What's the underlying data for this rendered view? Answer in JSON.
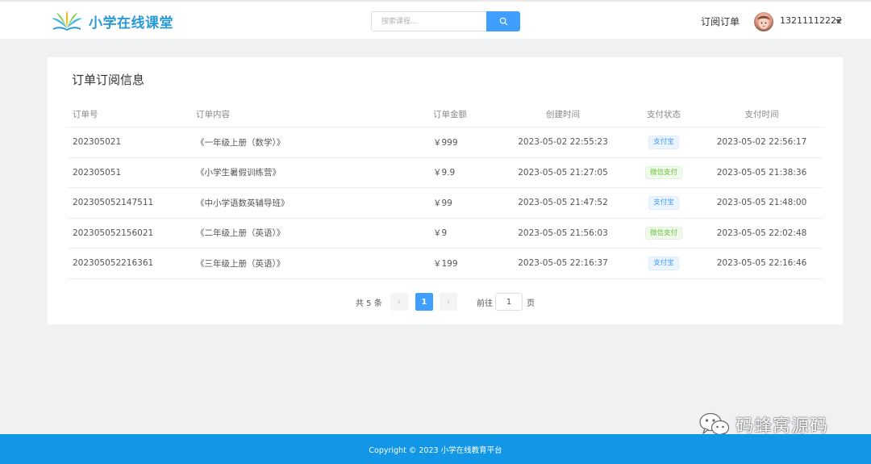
{
  "header": {
    "logo_text": "小学在线课堂",
    "search_placeholder": "搜索课程...",
    "nav_orders": "订阅订单",
    "username": "13211112222"
  },
  "card": {
    "title": "订单订阅信息",
    "columns": [
      "订单号",
      "订单内容",
      "订单金额",
      "创建时间",
      "支付状态",
      "支付时间"
    ],
    "rows": [
      {
        "order_no": "202305021",
        "content": "《一年级上册（数学）》",
        "amount": "￥999",
        "created": "2023-05-02 22:55:23",
        "pay_status": "支付宝",
        "pay_type": "alipay",
        "paid": "2023-05-02 22:56:17"
      },
      {
        "order_no": "202305051",
        "content": "《小学生暑假训练营》",
        "amount": "￥9.9",
        "created": "2023-05-05 21:27:05",
        "pay_status": "微信支付",
        "pay_type": "wechat",
        "paid": "2023-05-05 21:38:36"
      },
      {
        "order_no": "202305052147511",
        "content": "《中小学语数英辅导班》",
        "amount": "￥99",
        "created": "2023-05-05 21:47:52",
        "pay_status": "支付宝",
        "pay_type": "alipay",
        "paid": "2023-05-05 21:48:00"
      },
      {
        "order_no": "202305052156021",
        "content": "《二年级上册（英语）》",
        "amount": "￥9",
        "created": "2023-05-05 21:56:03",
        "pay_status": "微信支付",
        "pay_type": "wechat",
        "paid": "2023-05-05 22:02:48"
      },
      {
        "order_no": "202305052216361",
        "content": "《三年级上册（英语）》",
        "amount": "￥199",
        "created": "2023-05-05 22:16:37",
        "pay_status": "支付宝",
        "pay_type": "alipay",
        "paid": "2023-05-05 22:16:46"
      }
    ]
  },
  "pagination": {
    "total": "共 5 条",
    "prev_icon": "‹",
    "current_page": "1",
    "next_icon": "›",
    "goto_label": "前往",
    "goto_value": "1",
    "goto_unit": "页"
  },
  "watermark": {
    "text": "码蜂窝源码"
  },
  "footer": {
    "copyright": "Copyright © 2023 小学在线教育平台"
  },
  "colors": {
    "primary": "#409eff",
    "footer_bg": "#1296e6",
    "logo_text": "#2a9ad6",
    "tag_alipay": "#409eff",
    "tag_wechat": "#67c23a"
  }
}
